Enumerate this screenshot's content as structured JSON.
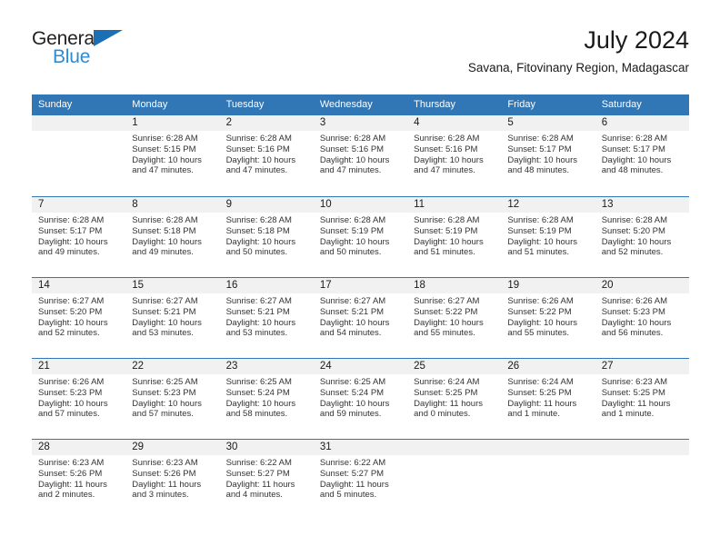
{
  "brand": {
    "line1": "General",
    "line2": "Blue",
    "triangle_color": "#1b6fb5",
    "line2_color": "#2b8cd4"
  },
  "header": {
    "title": "July 2024",
    "subtitle": "Savana, Fitovinany Region, Madagascar",
    "header_bg_color": "#3176b5",
    "daynum_band_color": "#f1f1f1"
  },
  "weekdays": [
    "Sunday",
    "Monday",
    "Tuesday",
    "Wednesday",
    "Thursday",
    "Friday",
    "Saturday"
  ],
  "weeks": [
    [
      {
        "day": "",
        "sunrise": "",
        "sunset": "",
        "daylight_line1": "",
        "daylight_line2": "",
        "empty": true
      },
      {
        "day": "1",
        "sunrise": "Sunrise: 6:28 AM",
        "sunset": "Sunset: 5:15 PM",
        "daylight_line1": "Daylight: 10 hours",
        "daylight_line2": "and 47 minutes.",
        "empty": false
      },
      {
        "day": "2",
        "sunrise": "Sunrise: 6:28 AM",
        "sunset": "Sunset: 5:16 PM",
        "daylight_line1": "Daylight: 10 hours",
        "daylight_line2": "and 47 minutes.",
        "empty": false
      },
      {
        "day": "3",
        "sunrise": "Sunrise: 6:28 AM",
        "sunset": "Sunset: 5:16 PM",
        "daylight_line1": "Daylight: 10 hours",
        "daylight_line2": "and 47 minutes.",
        "empty": false
      },
      {
        "day": "4",
        "sunrise": "Sunrise: 6:28 AM",
        "sunset": "Sunset: 5:16 PM",
        "daylight_line1": "Daylight: 10 hours",
        "daylight_line2": "and 47 minutes.",
        "empty": false
      },
      {
        "day": "5",
        "sunrise": "Sunrise: 6:28 AM",
        "sunset": "Sunset: 5:17 PM",
        "daylight_line1": "Daylight: 10 hours",
        "daylight_line2": "and 48 minutes.",
        "empty": false
      },
      {
        "day": "6",
        "sunrise": "Sunrise: 6:28 AM",
        "sunset": "Sunset: 5:17 PM",
        "daylight_line1": "Daylight: 10 hours",
        "daylight_line2": "and 48 minutes.",
        "empty": false
      }
    ],
    [
      {
        "day": "7",
        "sunrise": "Sunrise: 6:28 AM",
        "sunset": "Sunset: 5:17 PM",
        "daylight_line1": "Daylight: 10 hours",
        "daylight_line2": "and 49 minutes.",
        "empty": false
      },
      {
        "day": "8",
        "sunrise": "Sunrise: 6:28 AM",
        "sunset": "Sunset: 5:18 PM",
        "daylight_line1": "Daylight: 10 hours",
        "daylight_line2": "and 49 minutes.",
        "empty": false
      },
      {
        "day": "9",
        "sunrise": "Sunrise: 6:28 AM",
        "sunset": "Sunset: 5:18 PM",
        "daylight_line1": "Daylight: 10 hours",
        "daylight_line2": "and 50 minutes.",
        "empty": false
      },
      {
        "day": "10",
        "sunrise": "Sunrise: 6:28 AM",
        "sunset": "Sunset: 5:19 PM",
        "daylight_line1": "Daylight: 10 hours",
        "daylight_line2": "and 50 minutes.",
        "empty": false
      },
      {
        "day": "11",
        "sunrise": "Sunrise: 6:28 AM",
        "sunset": "Sunset: 5:19 PM",
        "daylight_line1": "Daylight: 10 hours",
        "daylight_line2": "and 51 minutes.",
        "empty": false
      },
      {
        "day": "12",
        "sunrise": "Sunrise: 6:28 AM",
        "sunset": "Sunset: 5:19 PM",
        "daylight_line1": "Daylight: 10 hours",
        "daylight_line2": "and 51 minutes.",
        "empty": false
      },
      {
        "day": "13",
        "sunrise": "Sunrise: 6:28 AM",
        "sunset": "Sunset: 5:20 PM",
        "daylight_line1": "Daylight: 10 hours",
        "daylight_line2": "and 52 minutes.",
        "empty": false
      }
    ],
    [
      {
        "day": "14",
        "sunrise": "Sunrise: 6:27 AM",
        "sunset": "Sunset: 5:20 PM",
        "daylight_line1": "Daylight: 10 hours",
        "daylight_line2": "and 52 minutes.",
        "empty": false
      },
      {
        "day": "15",
        "sunrise": "Sunrise: 6:27 AM",
        "sunset": "Sunset: 5:21 PM",
        "daylight_line1": "Daylight: 10 hours",
        "daylight_line2": "and 53 minutes.",
        "empty": false
      },
      {
        "day": "16",
        "sunrise": "Sunrise: 6:27 AM",
        "sunset": "Sunset: 5:21 PM",
        "daylight_line1": "Daylight: 10 hours",
        "daylight_line2": "and 53 minutes.",
        "empty": false
      },
      {
        "day": "17",
        "sunrise": "Sunrise: 6:27 AM",
        "sunset": "Sunset: 5:21 PM",
        "daylight_line1": "Daylight: 10 hours",
        "daylight_line2": "and 54 minutes.",
        "empty": false
      },
      {
        "day": "18",
        "sunrise": "Sunrise: 6:27 AM",
        "sunset": "Sunset: 5:22 PM",
        "daylight_line1": "Daylight: 10 hours",
        "daylight_line2": "and 55 minutes.",
        "empty": false
      },
      {
        "day": "19",
        "sunrise": "Sunrise: 6:26 AM",
        "sunset": "Sunset: 5:22 PM",
        "daylight_line1": "Daylight: 10 hours",
        "daylight_line2": "and 55 minutes.",
        "empty": false
      },
      {
        "day": "20",
        "sunrise": "Sunrise: 6:26 AM",
        "sunset": "Sunset: 5:23 PM",
        "daylight_line1": "Daylight: 10 hours",
        "daylight_line2": "and 56 minutes.",
        "empty": false
      }
    ],
    [
      {
        "day": "21",
        "sunrise": "Sunrise: 6:26 AM",
        "sunset": "Sunset: 5:23 PM",
        "daylight_line1": "Daylight: 10 hours",
        "daylight_line2": "and 57 minutes.",
        "empty": false
      },
      {
        "day": "22",
        "sunrise": "Sunrise: 6:25 AM",
        "sunset": "Sunset: 5:23 PM",
        "daylight_line1": "Daylight: 10 hours",
        "daylight_line2": "and 57 minutes.",
        "empty": false
      },
      {
        "day": "23",
        "sunrise": "Sunrise: 6:25 AM",
        "sunset": "Sunset: 5:24 PM",
        "daylight_line1": "Daylight: 10 hours",
        "daylight_line2": "and 58 minutes.",
        "empty": false
      },
      {
        "day": "24",
        "sunrise": "Sunrise: 6:25 AM",
        "sunset": "Sunset: 5:24 PM",
        "daylight_line1": "Daylight: 10 hours",
        "daylight_line2": "and 59 minutes.",
        "empty": false
      },
      {
        "day": "25",
        "sunrise": "Sunrise: 6:24 AM",
        "sunset": "Sunset: 5:25 PM",
        "daylight_line1": "Daylight: 11 hours",
        "daylight_line2": "and 0 minutes.",
        "empty": false
      },
      {
        "day": "26",
        "sunrise": "Sunrise: 6:24 AM",
        "sunset": "Sunset: 5:25 PM",
        "daylight_line1": "Daylight: 11 hours",
        "daylight_line2": "and 1 minute.",
        "empty": false
      },
      {
        "day": "27",
        "sunrise": "Sunrise: 6:23 AM",
        "sunset": "Sunset: 5:25 PM",
        "daylight_line1": "Daylight: 11 hours",
        "daylight_line2": "and 1 minute.",
        "empty": false
      }
    ],
    [
      {
        "day": "28",
        "sunrise": "Sunrise: 6:23 AM",
        "sunset": "Sunset: 5:26 PM",
        "daylight_line1": "Daylight: 11 hours",
        "daylight_line2": "and 2 minutes.",
        "empty": false
      },
      {
        "day": "29",
        "sunrise": "Sunrise: 6:23 AM",
        "sunset": "Sunset: 5:26 PM",
        "daylight_line1": "Daylight: 11 hours",
        "daylight_line2": "and 3 minutes.",
        "empty": false
      },
      {
        "day": "30",
        "sunrise": "Sunrise: 6:22 AM",
        "sunset": "Sunset: 5:27 PM",
        "daylight_line1": "Daylight: 11 hours",
        "daylight_line2": "and 4 minutes.",
        "empty": false
      },
      {
        "day": "31",
        "sunrise": "Sunrise: 6:22 AM",
        "sunset": "Sunset: 5:27 PM",
        "daylight_line1": "Daylight: 11 hours",
        "daylight_line2": "and 5 minutes.",
        "empty": false
      },
      {
        "day": "",
        "sunrise": "",
        "sunset": "",
        "daylight_line1": "",
        "daylight_line2": "",
        "empty": true
      },
      {
        "day": "",
        "sunrise": "",
        "sunset": "",
        "daylight_line1": "",
        "daylight_line2": "",
        "empty": true
      },
      {
        "day": "",
        "sunrise": "",
        "sunset": "",
        "daylight_line1": "",
        "daylight_line2": "",
        "empty": true
      }
    ]
  ]
}
